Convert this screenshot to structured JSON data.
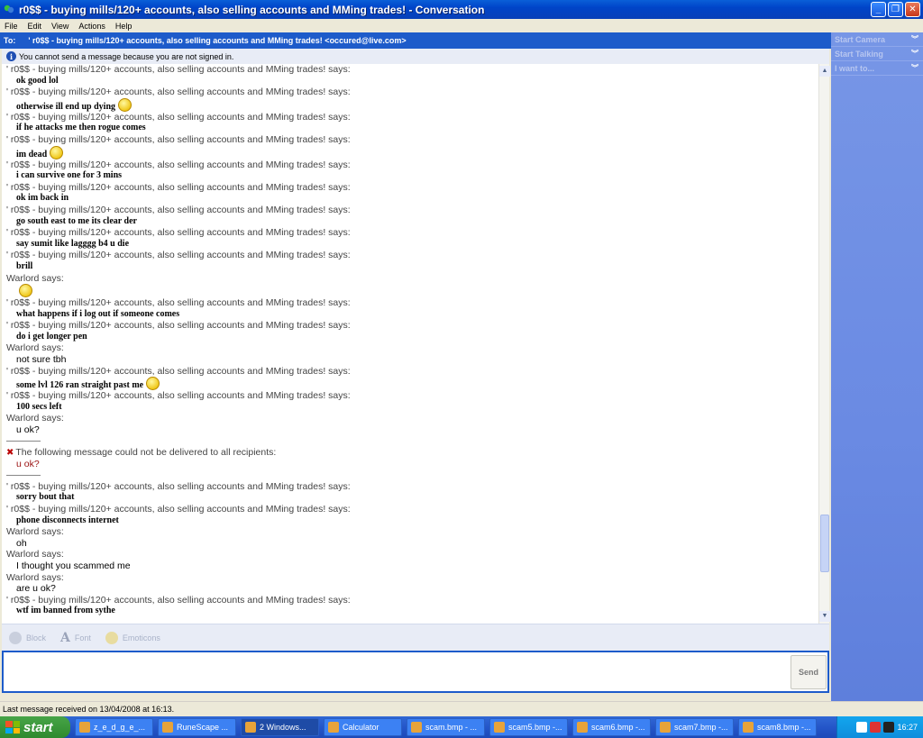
{
  "window": {
    "title": "r0$$ - buying mills/120+ accounts, also selling accounts and MMing trades! - Conversation"
  },
  "menu": [
    "File",
    "Edit",
    "View",
    "Actions",
    "Help"
  ],
  "to_bar": {
    "label": "To:",
    "recipient": "' r0$$ - buying mills/120+ accounts, also selling accounts and MMing trades! <occured@live.com>"
  },
  "side_panel": [
    "Start Camera",
    "Start Talking",
    "I want to..."
  ],
  "notice": "You cannot send a message because you are not signed in.",
  "conversation": [
    {
      "type": "hdr",
      "text": "' r0$$ - buying mills/120+ accounts, also selling accounts and MMing trades! says:"
    },
    {
      "type": "msg",
      "text": "ok good lol"
    },
    {
      "type": "hdr",
      "text": "' r0$$ - buying mills/120+ accounts, also selling accounts and MMing trades! says:"
    },
    {
      "type": "msg",
      "text": "otherwise ill end up dying",
      "emoticon": "sad"
    },
    {
      "type": "hdr",
      "text": "' r0$$ - buying mills/120+ accounts, also selling accounts and MMing trades! says:"
    },
    {
      "type": "msg",
      "text": "if he attacks me then rogue comes"
    },
    {
      "type": "hdr",
      "text": "' r0$$ - buying mills/120+ accounts, also selling accounts and MMing trades! says:"
    },
    {
      "type": "msg",
      "text": "im dead",
      "emoticon": "confused"
    },
    {
      "type": "hdr",
      "text": "' r0$$ - buying mills/120+ accounts, also selling accounts and MMing trades! says:"
    },
    {
      "type": "msg",
      "text": "i can survive one for 3 mins"
    },
    {
      "type": "hdr",
      "text": "' r0$$ - buying mills/120+ accounts, also selling accounts and MMing trades! says:"
    },
    {
      "type": "msg",
      "text": "ok im back in"
    },
    {
      "type": "hdr",
      "text": "' r0$$ - buying mills/120+ accounts, also selling accounts and MMing trades! says:"
    },
    {
      "type": "msg",
      "text": "go south east to me its clear der"
    },
    {
      "type": "hdr",
      "text": "' r0$$ - buying mills/120+ accounts, also selling accounts and MMing trades! says:"
    },
    {
      "type": "msg",
      "text": "say sumit like lagggg b4 u die"
    },
    {
      "type": "hdr",
      "text": "' r0$$ - buying mills/120+ accounts, also selling accounts and MMing trades! says:"
    },
    {
      "type": "msg",
      "text": "brill"
    },
    {
      "type": "hdr",
      "text": "Warlord says:"
    },
    {
      "type": "emo_only",
      "emoticon": "smile"
    },
    {
      "type": "hdr",
      "text": "' r0$$ - buying mills/120+ accounts, also selling accounts and MMing trades! says:"
    },
    {
      "type": "msg",
      "text": "what happens if i log out if someone comes"
    },
    {
      "type": "hdr",
      "text": "' r0$$ - buying mills/120+ accounts, also selling accounts and MMing trades! says:"
    },
    {
      "type": "msg",
      "text": "do i get longer pen"
    },
    {
      "type": "hdr",
      "text": "Warlord says:"
    },
    {
      "type": "plain",
      "text": "not sure tbh"
    },
    {
      "type": "hdr",
      "text": "' r0$$ - buying mills/120+ accounts, also selling accounts and MMing trades! says:"
    },
    {
      "type": "msg",
      "text": "some lvl 126 ran straight past me",
      "emoticon": "sad"
    },
    {
      "type": "hdr",
      "text": "' r0$$ - buying mills/120+ accounts, also selling accounts and MMing trades! says:"
    },
    {
      "type": "msg",
      "text": "100 secs left"
    },
    {
      "type": "hdr",
      "text": "Warlord says:"
    },
    {
      "type": "plain",
      "text": "u ok?"
    },
    {
      "type": "sep"
    },
    {
      "type": "warn",
      "text": "The following message could not be delivered to all recipients:"
    },
    {
      "type": "red",
      "text": "u ok?"
    },
    {
      "type": "sep"
    },
    {
      "type": "hdr",
      "text": "' r0$$ - buying mills/120+ accounts, also selling accounts and MMing trades! says:"
    },
    {
      "type": "msg",
      "text": "sorry bout that"
    },
    {
      "type": "hdr",
      "text": "' r0$$ - buying mills/120+ accounts, also selling accounts and MMing trades! says:"
    },
    {
      "type": "msg",
      "text": "phone disconnects internet"
    },
    {
      "type": "hdr",
      "text": "Warlord says:"
    },
    {
      "type": "plain",
      "text": "oh"
    },
    {
      "type": "hdr",
      "text": "Warlord says:"
    },
    {
      "type": "plain",
      "text": "I thought you scammed me"
    },
    {
      "type": "hdr",
      "text": "Warlord says:"
    },
    {
      "type": "plain",
      "text": "are u ok?"
    },
    {
      "type": "hdr",
      "text": "' r0$$ - buying mills/120+ accounts, also selling accounts and MMing trades! says:"
    },
    {
      "type": "msg",
      "text": "wtf im banned from sythe"
    }
  ],
  "toolbar": {
    "block": "Block",
    "font": "Font",
    "emoticons": "Emoticons"
  },
  "send_label": "Send",
  "status_text": "Last message received on 13/04/2008 at 16:13.",
  "taskbar": {
    "start": "start",
    "items": [
      "z_e_d_g_e_...",
      "RuneScape ...",
      "2 Windows...",
      "Calculator",
      "scam.bmp - ...",
      "scam5.bmp -...",
      "scam6.bmp -...",
      "scam7.bmp -...",
      "scam8.bmp -..."
    ],
    "active_index": 2,
    "clock": "16:27"
  }
}
